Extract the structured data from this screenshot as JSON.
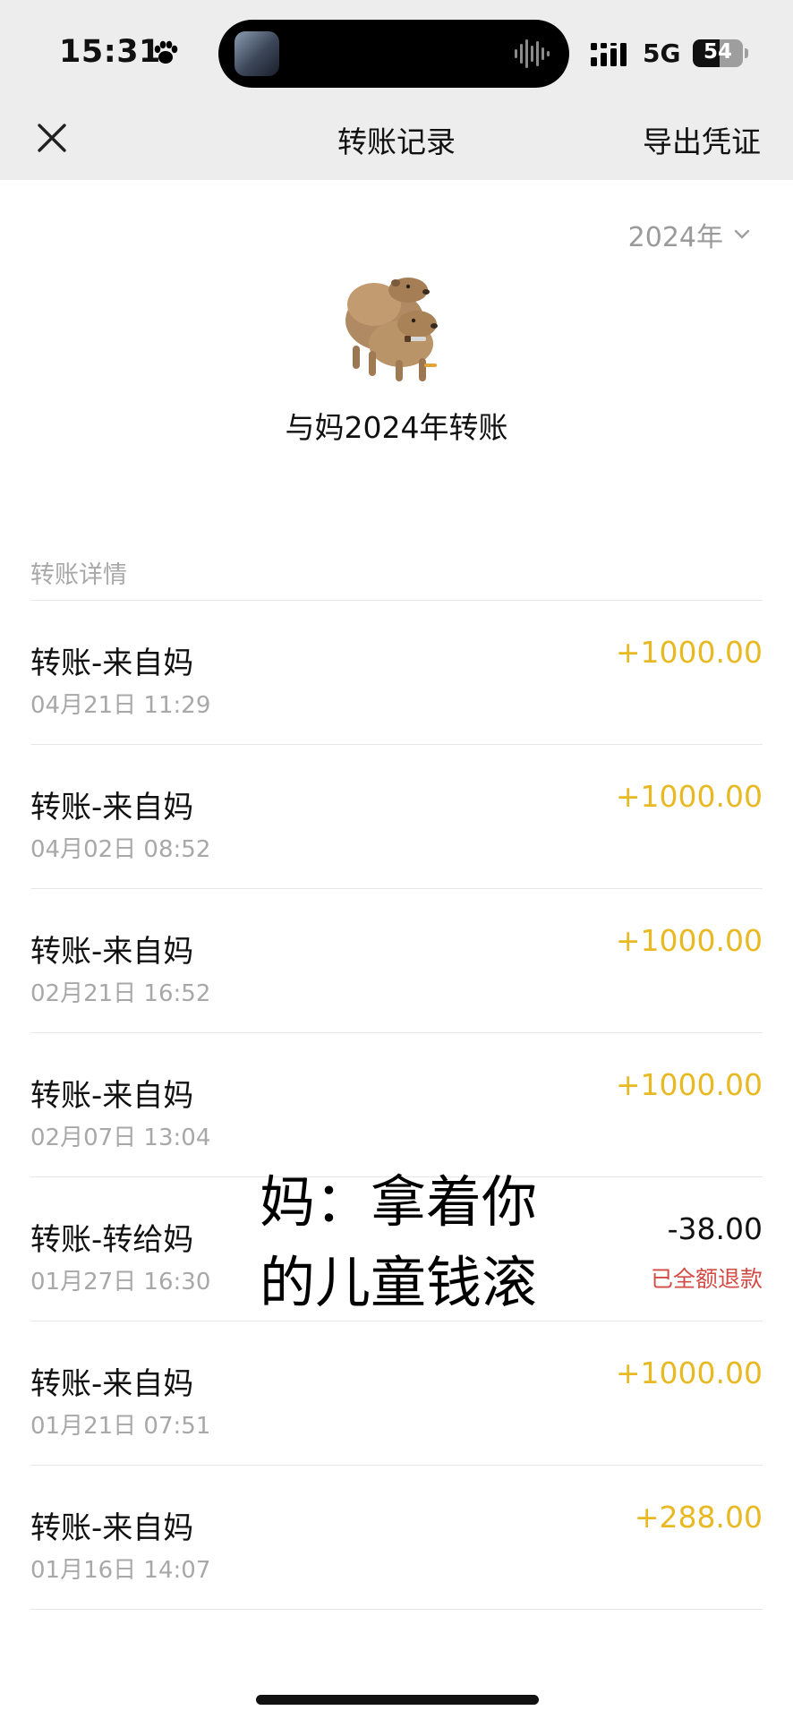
{
  "status_bar": {
    "time": "15:31",
    "network": "5G",
    "battery": "54",
    "battery_level": 0.54
  },
  "nav": {
    "title": "转账记录",
    "action": "导出凭证",
    "close_icon": "close-icon"
  },
  "year_filter": {
    "label": "2024年",
    "icon": "chevron-down-icon"
  },
  "summary": {
    "title": "与妈2024年转账"
  },
  "section_label": "转账详情",
  "transactions": [
    {
      "title": "转账-来自妈",
      "date": "04月21日 11:29",
      "amount": "+1000.00",
      "status": ""
    },
    {
      "title": "转账-来自妈",
      "date": "04月02日 08:52",
      "amount": "+1000.00",
      "status": ""
    },
    {
      "title": "转账-来自妈",
      "date": "02月21日 16:52",
      "amount": "+1000.00",
      "status": ""
    },
    {
      "title": "转账-来自妈",
      "date": "02月07日 13:04",
      "amount": "+1000.00",
      "status": ""
    },
    {
      "title": "转账-转给妈",
      "date": "01月27日 16:30",
      "amount": "-38.00",
      "status": "已全额退款"
    },
    {
      "title": "转账-来自妈",
      "date": "01月21日 07:51",
      "amount": "+1000.00",
      "status": ""
    },
    {
      "title": "转账-来自妈",
      "date": "01月16日 14:07",
      "amount": "+288.00",
      "status": ""
    }
  ],
  "overlay_caption": {
    "line1": "妈：拿着你",
    "line2": "的儿童钱滚"
  },
  "colors": {
    "income": "#e8b923",
    "refund": "#d24b45",
    "nav_bg": "#ededed"
  }
}
